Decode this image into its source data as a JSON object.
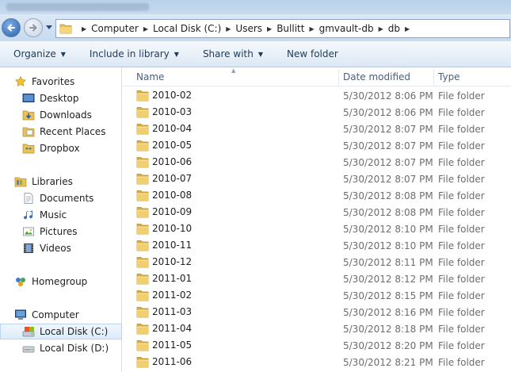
{
  "address": {
    "crumbs": [
      "Computer",
      "Local Disk (C:)",
      "Users",
      "Bullitt",
      "gmvault-db",
      "db"
    ]
  },
  "toolbar": {
    "organize": "Organize",
    "include_in_library": "Include in library",
    "share_with": "Share with",
    "new_folder": "New folder"
  },
  "nav": {
    "favorites": "Favorites",
    "desktop": "Desktop",
    "downloads": "Downloads",
    "recent_places": "Recent Places",
    "dropbox": "Dropbox",
    "libraries": "Libraries",
    "documents": "Documents",
    "music": "Music",
    "pictures": "Pictures",
    "videos": "Videos",
    "homegroup": "Homegroup",
    "computer": "Computer",
    "local_disk_c": "Local Disk (C:)",
    "local_disk_d": "Local Disk (D:)"
  },
  "columns": {
    "name": "Name",
    "date_modified": "Date modified",
    "type": "Type"
  },
  "files": [
    {
      "name": "2010-02",
      "date": "5/30/2012 8:06 PM",
      "type": "File folder"
    },
    {
      "name": "2010-03",
      "date": "5/30/2012 8:06 PM",
      "type": "File folder"
    },
    {
      "name": "2010-04",
      "date": "5/30/2012 8:07 PM",
      "type": "File folder"
    },
    {
      "name": "2010-05",
      "date": "5/30/2012 8:07 PM",
      "type": "File folder"
    },
    {
      "name": "2010-06",
      "date": "5/30/2012 8:07 PM",
      "type": "File folder"
    },
    {
      "name": "2010-07",
      "date": "5/30/2012 8:07 PM",
      "type": "File folder"
    },
    {
      "name": "2010-08",
      "date": "5/30/2012 8:08 PM",
      "type": "File folder"
    },
    {
      "name": "2010-09",
      "date": "5/30/2012 8:08 PM",
      "type": "File folder"
    },
    {
      "name": "2010-10",
      "date": "5/30/2012 8:10 PM",
      "type": "File folder"
    },
    {
      "name": "2010-11",
      "date": "5/30/2012 8:10 PM",
      "type": "File folder"
    },
    {
      "name": "2010-12",
      "date": "5/30/2012 8:11 PM",
      "type": "File folder"
    },
    {
      "name": "2011-01",
      "date": "5/30/2012 8:12 PM",
      "type": "File folder"
    },
    {
      "name": "2011-02",
      "date": "5/30/2012 8:15 PM",
      "type": "File folder"
    },
    {
      "name": "2011-03",
      "date": "5/30/2012 8:16 PM",
      "type": "File folder"
    },
    {
      "name": "2011-04",
      "date": "5/30/2012 8:18 PM",
      "type": "File folder"
    },
    {
      "name": "2011-05",
      "date": "5/30/2012 8:20 PM",
      "type": "File folder"
    },
    {
      "name": "2011-06",
      "date": "5/30/2012 8:21 PM",
      "type": "File folder"
    }
  ],
  "icons": {
    "back": "back-arrow-icon",
    "forward": "forward-arrow-icon",
    "folder": "folder-icon"
  },
  "colors": {
    "selection": "#dcebfc",
    "header_text": "#4c607a",
    "folder": "#e8c15a"
  }
}
